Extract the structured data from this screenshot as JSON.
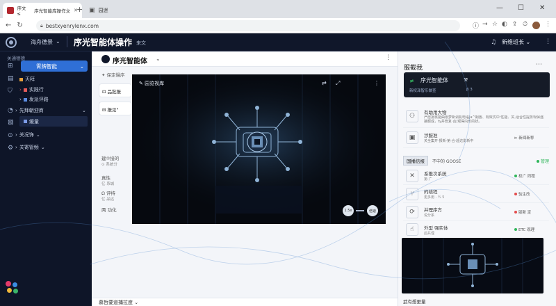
{
  "browser": {
    "tabs": [
      {
        "label": "序文 ≤",
        "active": false
      },
      {
        "label": "序光智能库操作文",
        "active": true
      },
      {
        "label": "园迷",
        "active": false
      }
    ],
    "url": "bestxyenrylenx.com"
  },
  "app": {
    "nav_dropdown": "海舟德景",
    "title": "序光智能体操作",
    "title_tag": "来文",
    "user_label": "新维班长"
  },
  "sidebar": {
    "section_title": "关通德德",
    "items": [
      {
        "icon": "grid-icon",
        "label": "霄牌智能",
        "active": true
      },
      {
        "icon": "doc-icon",
        "label": "天拜"
      },
      {
        "icon": "shield-icon",
        "label": "实践行"
      },
      {
        "icon": "list-icon",
        "label": "发派评路"
      },
      {
        "icon": "chart-icon",
        "label": "先拜朝迎商"
      },
      {
        "icon": "image-icon",
        "label": "缓量",
        "active": true
      },
      {
        "icon": "clock-icon",
        "label": "关况饰"
      },
      {
        "icon": "gear-icon",
        "label": "关寄管频"
      }
    ]
  },
  "main": {
    "header_title": "序光智能体",
    "subnote": "保定慢序",
    "rows": [
      "品批报",
      "报见\"",
      "建②接的",
      "真性",
      "Ω 评持",
      "两 功化"
    ],
    "sub_rows": [
      "⊙ 系统分",
      "亿 系城",
      "亿 品达"
    ],
    "footer_label": "慕哲要道捕拉度"
  },
  "video": {
    "title": "园览视库",
    "speed_label": "1.5x",
    "quality_label": "倍速"
  },
  "right": {
    "title": "服截我",
    "profile_name": "序光智能体",
    "profile_sub": "新权泽智乐做查",
    "profile_tag": "β 3",
    "rows": [
      {
        "title": "有助用大物",
        "desc": "严居批核能曲限梦新调机电语Ja^期置、有效优中:性能、实,话合性提务现保遇接额成，ty并管复·合/观得内形的状。"
      },
      {
        "title": "涉服准",
        "desc": "关全集开·报新·第·合·超达影新中",
        "action": "新闻新称"
      }
    ],
    "tabs_label": "国播信报",
    "tabs_sub": "不中的 GOOSE",
    "tabs_status": "管理",
    "list": [
      {
        "title": "系推次系统",
        "sub": "第·广",
        "action": "权广 同程"
      },
      {
        "title": "的结程",
        "sub": "更多用",
        "meta": "· ¼ 5",
        "action": "验生改"
      },
      {
        "title": "并理序方",
        "sub": "说分系",
        "action": "版新 定"
      },
      {
        "title": "外型 强实体",
        "sub": "后共理",
        "action": "ETC 观理"
      }
    ],
    "bottom_label": "武有想更量"
  },
  "colors": {
    "accent": "#2f6fd6",
    "panel_dark": "#0e1528",
    "green": "#2fb65a"
  }
}
